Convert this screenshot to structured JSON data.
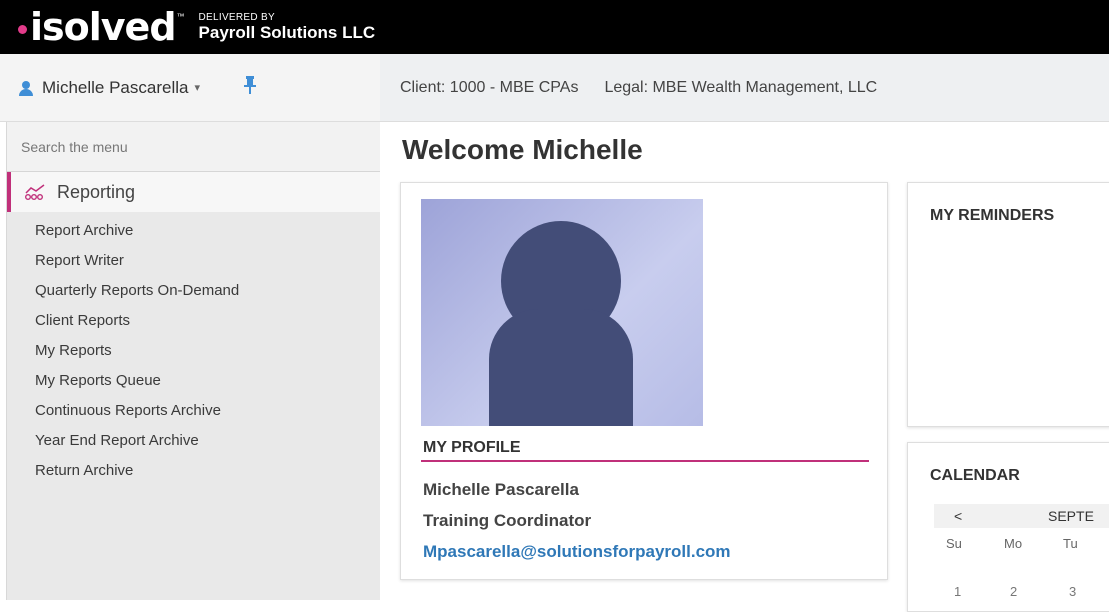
{
  "brand": {
    "logo_text": "isolved",
    "tm": "™",
    "delivered_by": "DELIVERED BY",
    "provider": "Payroll Solutions LLC",
    "accent": "#e23b8a"
  },
  "user": {
    "name": "Michelle Pascarella",
    "caret": "▾",
    "pin": "📌"
  },
  "client": {
    "client_text": "Client: 1000 - MBE CPAs",
    "legal_text": "Legal: MBE Wealth Management, LLC"
  },
  "sidebar": {
    "search_placeholder": "Search the menu",
    "section_label": "Reporting",
    "section_icon": "reporting-icon",
    "items": [
      {
        "label": "Report Archive"
      },
      {
        "label": "Report Writer"
      },
      {
        "label": "Quarterly Reports On-Demand"
      },
      {
        "label": "Client Reports"
      },
      {
        "label": "My Reports"
      },
      {
        "label": "My Reports Queue"
      },
      {
        "label": "Continuous Reports Archive"
      },
      {
        "label": "Year End Report Archive"
      },
      {
        "label": "Return Archive"
      }
    ]
  },
  "main": {
    "welcome": "Welcome Michelle",
    "profile": {
      "title": "MY PROFILE",
      "name": "Michelle Pascarella",
      "role": "Training Coordinator",
      "email": "Mpascarella@solutionsforpayroll.com"
    },
    "reminders": {
      "title": "MY REMINDERS"
    },
    "calendar": {
      "title": "CALENDAR",
      "prev": "<",
      "month": "SEPTE",
      "dow": [
        "Su",
        "Mo",
        "Tu"
      ],
      "days": [
        "1",
        "2",
        "3"
      ]
    }
  },
  "colors": {
    "accent_pink": "#c0307a",
    "link_blue": "#2f78b7",
    "icon_blue": "#3f8ed6"
  }
}
